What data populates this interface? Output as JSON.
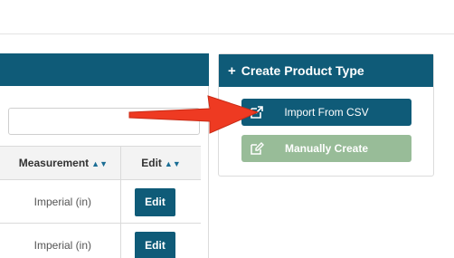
{
  "product_type_panel": {
    "title": "Create Product Type",
    "import_label": "Import From CSV",
    "manual_label": "Manually Create"
  },
  "table": {
    "columns": [
      "Measurement",
      "Edit"
    ],
    "rows": [
      {
        "measurement": "Imperial (in)",
        "edit": "Edit"
      },
      {
        "measurement": "Imperial (in)",
        "edit": "Edit"
      }
    ]
  },
  "search": {
    "value": "",
    "placeholder": ""
  },
  "colors": {
    "primary": "#0f5b78",
    "success_muted": "#98bc98",
    "annotation_arrow": "#ee3a22"
  }
}
